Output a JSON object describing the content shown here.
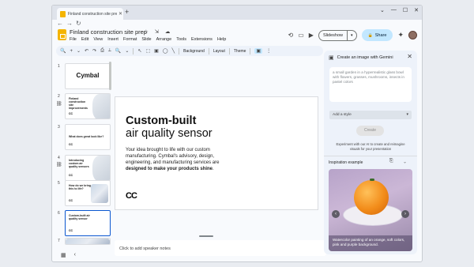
{
  "browser": {
    "tab_title": "Finland construction site prep",
    "tab_close": "✕",
    "new_tab": "+",
    "controls": [
      "⌄",
      "—",
      "☐",
      "✕"
    ],
    "nav": [
      "←",
      "→",
      "↻"
    ]
  },
  "document": {
    "title": "Finland construction site prep",
    "title_icons": "☆ ⇲ ☁",
    "menus": [
      "File",
      "Edit",
      "View",
      "Insert",
      "Format",
      "Slide",
      "Arrange",
      "Tools",
      "Extensions",
      "Help"
    ]
  },
  "header": {
    "history_icon": "⟲",
    "comment_icon": "▭",
    "camera_icon": "▶",
    "slideshow_label": "Slideshow",
    "slideshow_dropdown": "▾",
    "share_icon": "🔒",
    "share_label": "Share",
    "gemini_icon": "✦"
  },
  "toolbar": {
    "icons": [
      "🔍",
      "+",
      "⌄",
      "↶",
      "↷",
      "⎙",
      "⟂",
      "🔍",
      "⌄"
    ],
    "tools": [
      "↖",
      "⬚",
      "▣",
      "◯",
      "╲"
    ],
    "buttons": [
      "Background",
      "Layout",
      "Theme"
    ],
    "more_icon": "⋮"
  },
  "filmstrip": {
    "slides": [
      {
        "num": "1",
        "text": "Cymbal",
        "kind": "logo"
      },
      {
        "num": "2",
        "text": "Finland construction site improvements",
        "kind": "blob"
      },
      {
        "num": "3",
        "text": "What does great look like?",
        "kind": "plain"
      },
      {
        "num": "4",
        "text": "Introducing custom air quality sensors",
        "kind": "blob"
      },
      {
        "num": "5",
        "text": "How do we bring this to life?",
        "kind": "img"
      },
      {
        "num": "6",
        "text": "Custom-built air quality sensor",
        "kind": "plain"
      },
      {
        "num": "7",
        "text": "",
        "kind": "img"
      }
    ]
  },
  "slide": {
    "heading_line1": "Custom-built",
    "heading_line2": "air quality sensor",
    "body_plain": "Your idea brought to life with our custom manufacturing. Cymbal's advisory, design, engineering, and manufacturing services are ",
    "body_bold": "designed to make your products shine",
    "body_end": ".",
    "brand_mark": "CC"
  },
  "notes": {
    "placeholder": "Click to add speaker notes"
  },
  "bottom": {
    "grid_icon": "▦",
    "collapse_icon": "‹"
  },
  "gemini_panel": {
    "title": "Create an image with Gemini",
    "close": "✕",
    "prompt_placeholder": "a small garden in a hyperrealistic glass bowl with flowers, grasses, mushrooms, insects in pastel colors",
    "style_label": "Add a style",
    "style_chevron": "▾",
    "create_label": "Create",
    "experiment_text": "Experiment with our AI to create and reimagine visuals for your presentation",
    "inspiration_label": "Inspiration example",
    "inspiration_icons": "⎘ ⌄",
    "prev": "‹",
    "next": "›",
    "caption": "Watercolor painting of an orange, soft colors, pink and purple background."
  }
}
